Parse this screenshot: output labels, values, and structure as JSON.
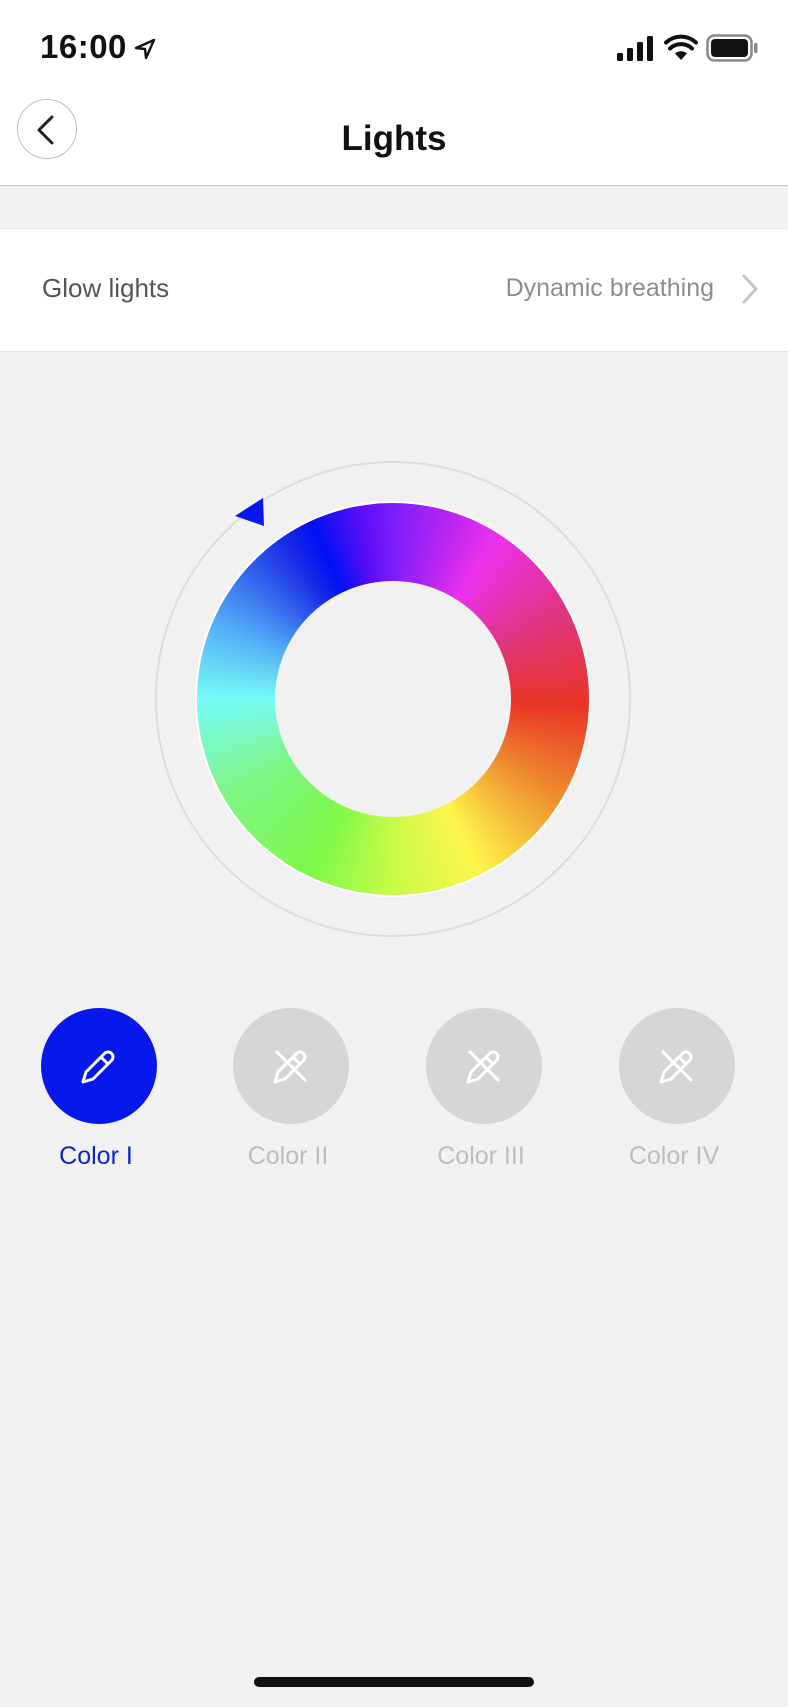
{
  "status_bar": {
    "time": "16:00",
    "icons": [
      "location-arrow-icon",
      "cellular-signal-icon",
      "wifi-icon",
      "battery-icon"
    ]
  },
  "nav": {
    "title": "Lights",
    "back_icon": "chevron-left-icon"
  },
  "glow_row": {
    "label": "Glow lights",
    "value": "Dynamic breathing",
    "icon": "chevron-right-icon"
  },
  "color_wheel": {
    "selected_color": "#0010f5"
  },
  "swatches": [
    {
      "label": "Color I",
      "active": true,
      "color": "#0718ec",
      "icon": "eyedropper-icon"
    },
    {
      "label": "Color II",
      "active": false,
      "color": "#d6d6d6",
      "icon": "eyedropper-disabled-icon"
    },
    {
      "label": "Color III",
      "active": false,
      "color": "#d6d6d6",
      "icon": "eyedropper-disabled-icon"
    },
    {
      "label": "Color IV",
      "active": false,
      "color": "#d6d6d6",
      "icon": "eyedropper-disabled-icon"
    }
  ],
  "colors": {
    "accent": "#0718ec",
    "accent_text": "#0f24c8",
    "background": "#f1f1f1"
  }
}
